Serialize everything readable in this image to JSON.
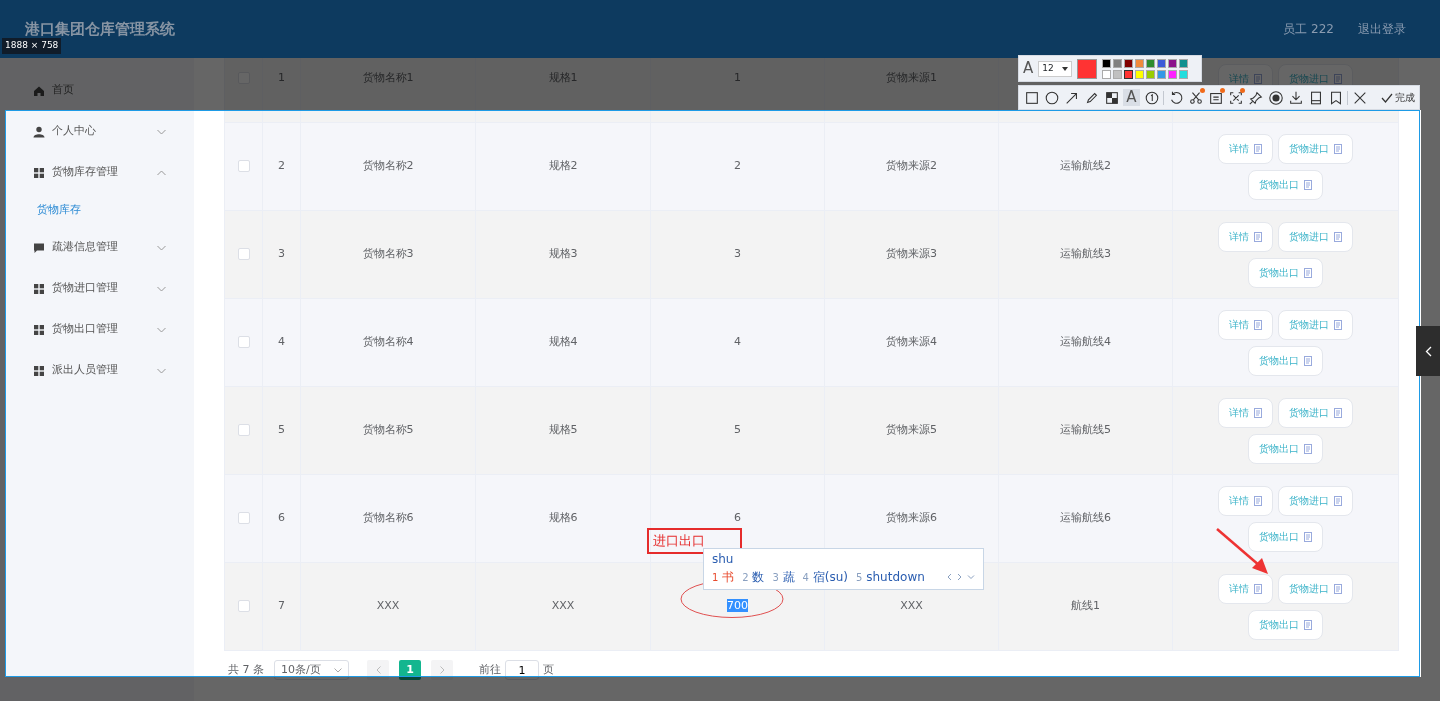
{
  "header": {
    "title": "港口集团仓库管理系统",
    "user": "员工 222",
    "logout": "退出登录"
  },
  "sidebar": {
    "items": [
      {
        "label": "首页",
        "kind": "home"
      },
      {
        "label": "个人中心",
        "kind": "user",
        "expanded": false
      },
      {
        "label": "货物库存管理",
        "kind": "grid",
        "expanded": true,
        "children": [
          {
            "label": "货物库存",
            "selected": true
          }
        ]
      },
      {
        "label": "疏港信息管理",
        "kind": "chat",
        "expanded": false
      },
      {
        "label": "货物进口管理",
        "kind": "grid",
        "expanded": false
      },
      {
        "label": "货物出口管理",
        "kind": "grid",
        "expanded": false
      },
      {
        "label": "派出人员管理",
        "kind": "grid",
        "expanded": false
      }
    ]
  },
  "table": {
    "rows": [
      {
        "checked": false,
        "index": "1",
        "name": "货物名称1",
        "spec": "规格1",
        "qty": "1",
        "qty_highlighted": false,
        "source": "货物来源1",
        "actions": [
          "详情",
          "货物进口"
        ]
      },
      {
        "checked": false,
        "index": "2",
        "name": "货物名称2",
        "spec": "规格2",
        "qty": "2",
        "qty_highlighted": false,
        "source": "货物来源2",
        "route": "运输航线2",
        "actions": [
          "详情",
          "货物进口",
          "货物出口"
        ]
      },
      {
        "checked": false,
        "index": "3",
        "name": "货物名称3",
        "spec": "规格3",
        "qty": "3",
        "qty_highlighted": false,
        "source": "货物来源3",
        "route": "运输航线3",
        "actions": [
          "详情",
          "货物进口",
          "货物出口"
        ]
      },
      {
        "checked": false,
        "index": "4",
        "name": "货物名称4",
        "spec": "规格4",
        "qty": "4",
        "qty_highlighted": false,
        "source": "货物来源4",
        "route": "运输航线4",
        "actions": [
          "详情",
          "货物进口",
          "货物出口"
        ]
      },
      {
        "checked": false,
        "index": "5",
        "name": "货物名称5",
        "spec": "规格5",
        "qty": "5",
        "qty_highlighted": false,
        "source": "货物来源5",
        "route": "运输航线5",
        "actions": [
          "详情",
          "货物进口",
          "货物出口"
        ]
      },
      {
        "checked": false,
        "index": "6",
        "name": "货物名称6",
        "spec": "规格6",
        "qty": "6",
        "qty_highlighted": false,
        "source": "货物来源6",
        "route": "运输航线6",
        "actions": [
          "详情",
          "货物进口",
          "货物出口"
        ]
      },
      {
        "checked": false,
        "index": "7",
        "name": "XXX",
        "spec": "XXX",
        "qty": "700",
        "qty_highlighted": true,
        "source": "XXX",
        "route": "航线1",
        "actions": [
          "详情",
          "货物进口",
          "货物出口"
        ]
      }
    ]
  },
  "pagination": {
    "total": "共 7 条",
    "page_size": "10条/页",
    "pages": [
      {
        "label": "1",
        "selected": true
      }
    ],
    "goto_label": "前往",
    "goto_value": "1",
    "goto_suffix": "页"
  },
  "capture_tool": {
    "size_label": "1888 × 758",
    "text_settings": {
      "tool_glyph": "A",
      "font_size": "12",
      "palette": [
        {
          "color": "#000000",
          "selected": false
        },
        {
          "color": "#808080",
          "selected": false
        },
        {
          "color": "#800000",
          "selected": false
        },
        {
          "color": "#f08a3c",
          "selected": false
        },
        {
          "color": "#2e8b2e",
          "selected": false
        },
        {
          "color": "#3c5ad8",
          "selected": false
        },
        {
          "color": "#8b138b",
          "selected": false
        },
        {
          "color": "#109090",
          "selected": false
        },
        {
          "color": "#ffffff",
          "selected": false
        },
        {
          "color": "#c0c0c0",
          "selected": false
        },
        {
          "color": "#ff3333",
          "selected": true
        },
        {
          "color": "#ffff00",
          "selected": false
        },
        {
          "color": "#99cc00",
          "selected": false
        },
        {
          "color": "#3399e6",
          "selected": false
        },
        {
          "color": "#ff22ff",
          "selected": false
        },
        {
          "color": "#22dddd",
          "selected": false
        }
      ]
    },
    "tools": [
      {
        "kind": "rect",
        "selected": false,
        "dot": false
      },
      {
        "kind": "ellipse",
        "selected": false,
        "dot": false
      },
      {
        "kind": "arrow",
        "selected": false,
        "dot": false
      },
      {
        "kind": "pencil",
        "selected": false,
        "dot": false
      },
      {
        "kind": "mosaic",
        "selected": false,
        "dot": false
      },
      {
        "kind": "text",
        "label": "A",
        "selected": true,
        "dot": false
      },
      {
        "kind": "number",
        "selected": false,
        "dot": false
      },
      {
        "kind": "sep"
      },
      {
        "kind": "undo",
        "selected": false,
        "dot": false
      },
      {
        "kind": "scissors",
        "selected": false,
        "dot": true
      },
      {
        "kind": "ocr",
        "selected": false,
        "dot": true
      },
      {
        "kind": "scan",
        "selected": false,
        "dot": true
      },
      {
        "kind": "pin",
        "selected": false,
        "dot": false
      },
      {
        "kind": "record",
        "selected": false,
        "dot": false
      },
      {
        "kind": "download",
        "selected": false,
        "dot": false
      },
      {
        "kind": "save",
        "selected": false,
        "dot": false
      },
      {
        "kind": "bookmark",
        "selected": false,
        "dot": false
      },
      {
        "kind": "sep"
      },
      {
        "kind": "close",
        "selected": false,
        "dot": false
      }
    ],
    "done_label": "完成",
    "annotation_text": "进口出口",
    "ime": {
      "composition": "shu",
      "candidates": [
        {
          "num": "1",
          "text": "书",
          "selected": true
        },
        {
          "num": "2",
          "text": "数",
          "selected": false
        },
        {
          "num": "3",
          "text": "蔬",
          "selected": false
        },
        {
          "num": "4",
          "text": "宿(su)",
          "selected": false
        },
        {
          "num": "5",
          "text": "shutdown",
          "selected": false
        }
      ]
    }
  }
}
